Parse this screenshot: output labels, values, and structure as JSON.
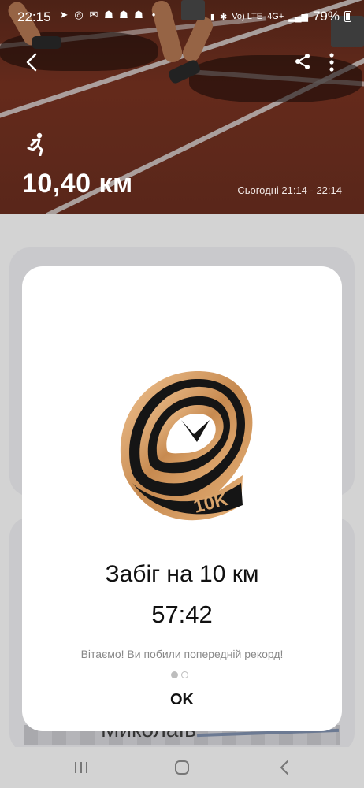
{
  "status_bar": {
    "time": "22:15",
    "app_icons": [
      "telegram-icon",
      "instagram-icon",
      "messenger-icon",
      "ghost-icon",
      "ghost-icon",
      "ghost-icon"
    ],
    "network_label": "Vo) LTE",
    "network_type": "4G+",
    "battery_percent": "79%"
  },
  "header": {
    "distance": "10,40 км",
    "time_range": "Сьогодні 21:14 - 22:14",
    "activity_icon": "running-icon"
  },
  "background": {
    "partial_text": "Миколаїв"
  },
  "dialog": {
    "title": "Забіг на 10 км",
    "value": "57:42",
    "message": "Вітаємо! Ви побили попередній рекорд!",
    "badge_label": "10K",
    "ok_label": "OK",
    "pages": 2,
    "active_page": 1
  },
  "colors": {
    "track_red": "#7b3422",
    "badge_gold": "#c9955a",
    "badge_black": "#151515"
  }
}
